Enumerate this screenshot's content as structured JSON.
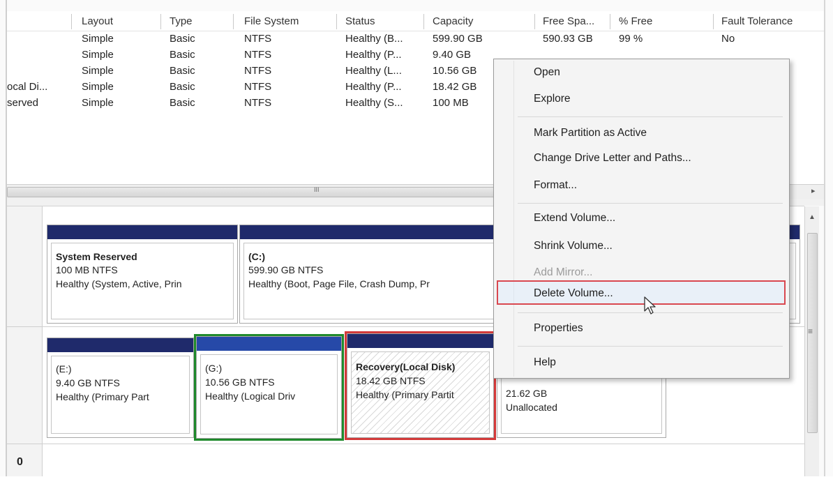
{
  "columns": [
    "Layout",
    "Type",
    "File System",
    "Status",
    "Capacity",
    "Free Spa...",
    "% Free",
    "Fault Tolerance"
  ],
  "rows": [
    {
      "volume": "",
      "layout": "Simple",
      "type": "Basic",
      "fs": "NTFS",
      "status": "Healthy (B...",
      "capacity": "599.90 GB",
      "free": "590.93 GB",
      "pct": "99 %",
      "fault": "No"
    },
    {
      "volume": "",
      "layout": "Simple",
      "type": "Basic",
      "fs": "NTFS",
      "status": "Healthy (P...",
      "capacity": "9.40 GB",
      "free": "",
      "pct": "",
      "fault": ""
    },
    {
      "volume": "",
      "layout": "Simple",
      "type": "Basic",
      "fs": "NTFS",
      "status": "Healthy (L...",
      "capacity": "10.56 GB",
      "free": "",
      "pct": "",
      "fault": ""
    },
    {
      "volume": "ocal Di...",
      "layout": "Simple",
      "type": "Basic",
      "fs": "NTFS",
      "status": "Healthy (P...",
      "capacity": "18.42 GB",
      "free": "",
      "pct": "",
      "fault": ""
    },
    {
      "volume": "served",
      "layout": "Simple",
      "type": "Basic",
      "fs": "NTFS",
      "status": "Healthy (S...",
      "capacity": "100 MB",
      "free": "",
      "pct": "",
      "fault": ""
    }
  ],
  "scroll_grip": "III",
  "disk0_partitions": [
    {
      "title": "System Reserved",
      "size": "100 MB NTFS",
      "status": "Healthy (System, Active, Prin"
    },
    {
      "title": "(C:)",
      "size": "599.90 GB NTFS",
      "status": "Healthy (Boot, Page File, Crash Dump, Pr"
    }
  ],
  "disk1_partitions": [
    {
      "title": "(E:)",
      "size": "9.40 GB NTFS",
      "status": "Healthy (Primary Part"
    },
    {
      "title": "(G:)",
      "size": "10.56 GB NTFS",
      "status": "Healthy (Logical Driv"
    },
    {
      "title": "Recovery(Local Disk)",
      "size": "18.42 GB NTFS",
      "status": "Healthy (Primary Partit"
    },
    {
      "title": "",
      "size": "21.62 GB",
      "status": "Unallocated"
    }
  ],
  "disk_label": "0",
  "context_menu": {
    "open": "Open",
    "explore": "Explore",
    "mark_active": "Mark Partition as Active",
    "change_letter": "Change Drive Letter and Paths...",
    "format": "Format...",
    "extend": "Extend Volume...",
    "shrink": "Shrink Volume...",
    "add_mirror": "Add Mirror...",
    "delete": "Delete Volume...",
    "properties": "Properties",
    "help": "Help"
  },
  "colors": {
    "primary_bar": "#1f2a6b",
    "logical_bar": "#2649a8",
    "green_outline": "#1f8a2c",
    "red_outline": "#d33a3a"
  }
}
